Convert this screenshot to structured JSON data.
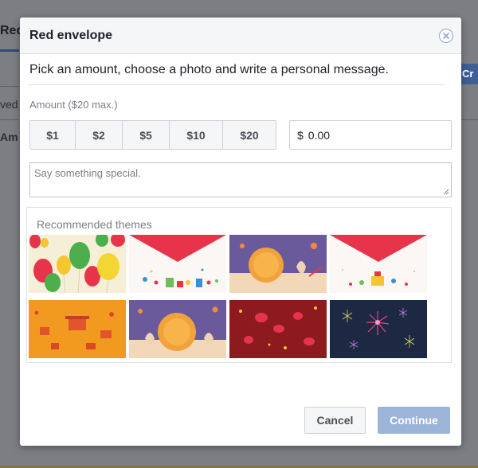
{
  "background": {
    "tab_fragment": "Red",
    "row_fragment_1": "ved",
    "row_fragment_2": "Am",
    "button_fragment": "Cr"
  },
  "dialog": {
    "title": "Red envelope",
    "intro": "Pick an amount, choose a photo and write a personal message.",
    "amount_label": "Amount ($20 max.)",
    "amount_options": [
      "$1",
      "$2",
      "$5",
      "$10",
      "$20"
    ],
    "amount_input": {
      "currency": "$",
      "value": "0.00"
    },
    "message_placeholder": "Say something special.",
    "themes_label": "Recommended themes",
    "themes": [
      "balloons",
      "red-envelope-party",
      "mooncake-rabbit",
      "red-envelope-gifts",
      "orange-festival",
      "mooncake-rabbit-2",
      "red-lanterns",
      "fireworks"
    ],
    "cancel_label": "Cancel",
    "continue_label": "Continue"
  },
  "colors": {
    "accent_blue": "#9cb4d8",
    "header_bg": "#f5f6f7",
    "red": "#e8344a",
    "overlay": "#7c7e83"
  },
  "icons": {
    "close": "close-circle-icon"
  }
}
